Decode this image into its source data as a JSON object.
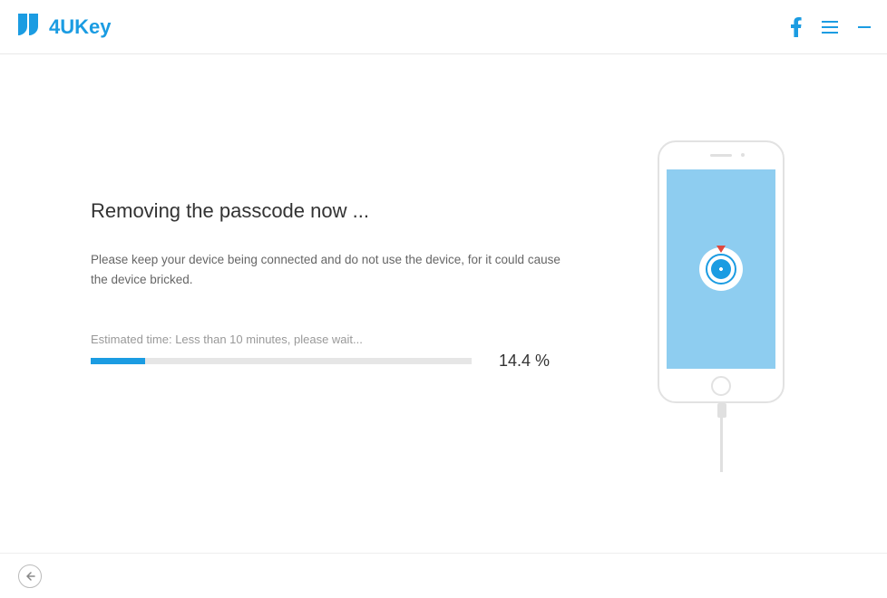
{
  "app": {
    "name": "4UKey"
  },
  "main": {
    "heading": "Removing the passcode now ...",
    "instruction": "Please keep your device being connected and do not use the device, for it could cause the device bricked.",
    "estimated_label": "Estimated time: Less than 10 minutes, please wait...",
    "progress_percent_value": 14.4,
    "progress_percent_label": "14.4 %"
  },
  "colors": {
    "accent": "#1b9ce2"
  }
}
